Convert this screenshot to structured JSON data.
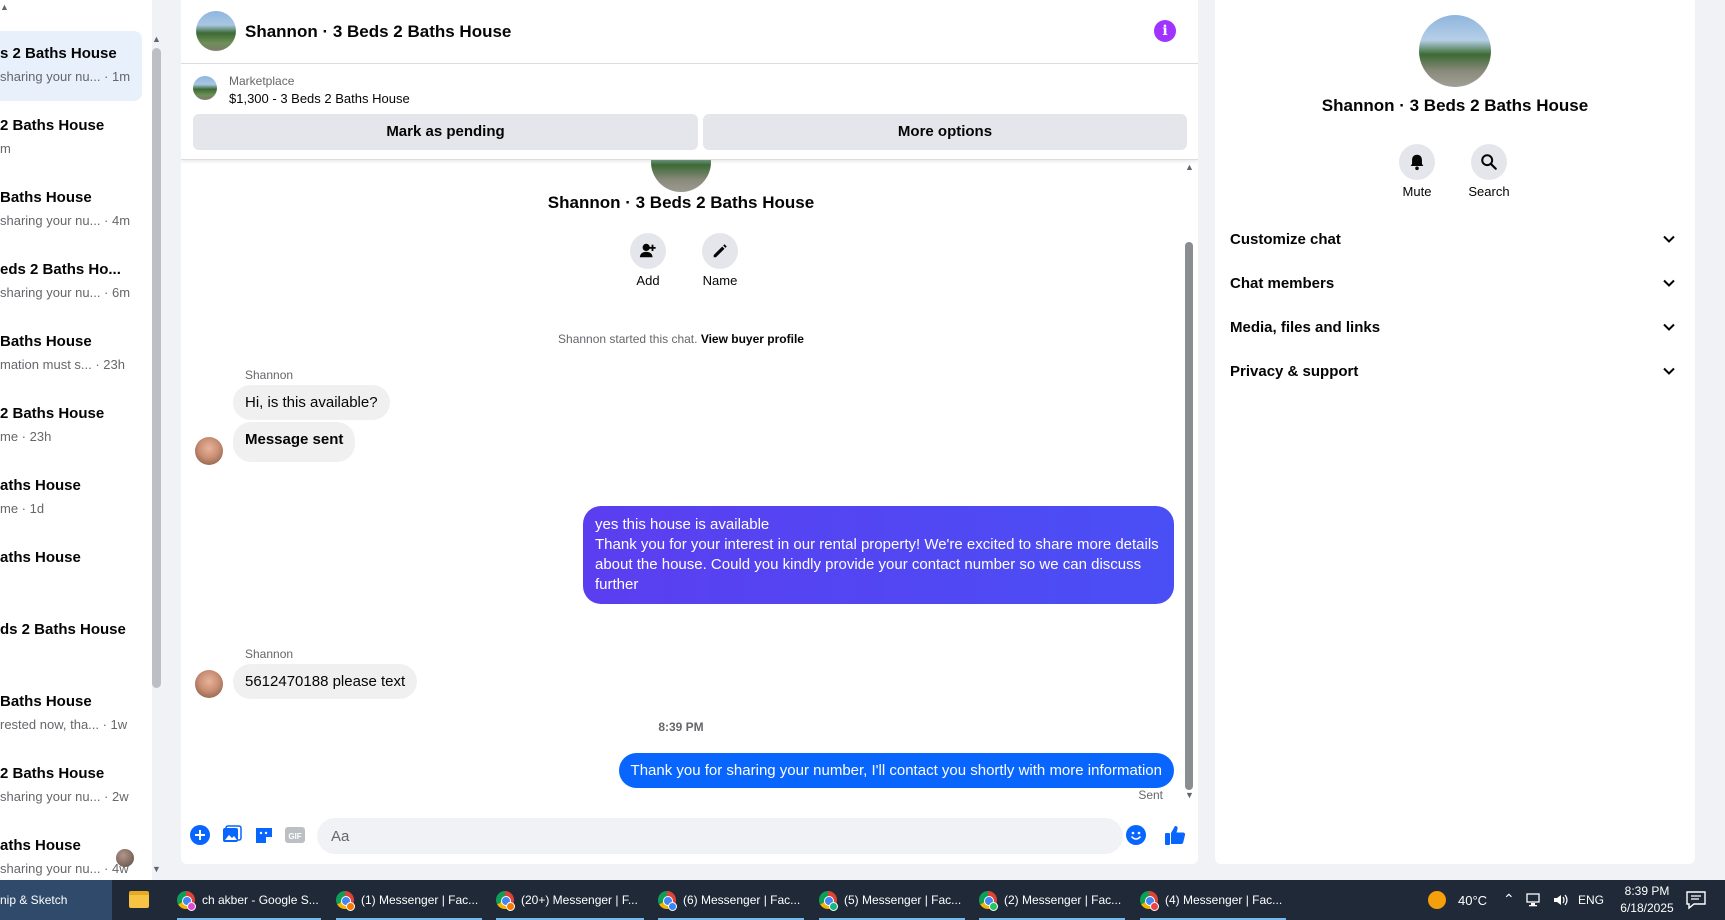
{
  "chat_list": {
    "items": [
      {
        "title": "s 2 Baths House",
        "subtitle": "sharing your nu... · 1m",
        "active": true
      },
      {
        "title": "2 Baths House",
        "subtitle": "m",
        "active": false
      },
      {
        "title": "Baths House",
        "subtitle": "sharing your nu... · 4m",
        "active": false
      },
      {
        "title": "eds 2 Baths Ho...",
        "subtitle": "sharing your nu... · 6m",
        "active": false
      },
      {
        "title": "Baths House",
        "subtitle": "mation must s... · 23h",
        "active": false
      },
      {
        "title": "2 Baths House",
        "subtitle": "me · 23h",
        "active": false
      },
      {
        "title": "aths House",
        "subtitle": "me · 1d",
        "active": false
      },
      {
        "title": "aths House",
        "subtitle": "",
        "active": false
      },
      {
        "title": "ds 2 Baths House",
        "subtitle": "",
        "active": false
      },
      {
        "title": "Baths House",
        "subtitle": "rested now, tha... · 1w",
        "active": false
      },
      {
        "title": "2 Baths House",
        "subtitle": "sharing your nu... · 2w",
        "active": false
      },
      {
        "title": "aths House",
        "subtitle": "sharing your nu... · 4w",
        "active": false
      }
    ]
  },
  "conversation": {
    "title": "Shannon · 3 Beds 2 Baths House",
    "listing": {
      "source": "Marketplace",
      "description": "$1,300 - 3 Beds 2 Baths House",
      "pending_label": "Mark as pending",
      "more_label": "More options"
    },
    "intro": {
      "name": "Shannon · 3 Beds 2 Baths House",
      "add_label": "Add",
      "name_label": "Name",
      "started_text": "Shannon started this chat.",
      "profile_link": "View buyer profile"
    },
    "messages": {
      "sender_1": "Shannon",
      "in_1": "Hi, is this available?",
      "in_2": "Message sent",
      "out_1": "yes this house is available\nThank you for your interest in our rental property! We're excited to share more details about the house. Could you kindly provide your contact number so we can discuss further",
      "sender_2": "Shannon",
      "in_3": "5612470188 please text",
      "time_divider": "8:39 PM",
      "out_2": "Thank you for sharing your number, I'll contact you shortly with more information",
      "status": "Sent"
    },
    "composer": {
      "placeholder": "Aa",
      "value": ""
    }
  },
  "info_panel": {
    "name": "Shannon · 3 Beds 2 Baths House",
    "mute_label": "Mute",
    "search_label": "Search",
    "sections": [
      {
        "label": "Customize chat"
      },
      {
        "label": "Chat members"
      },
      {
        "label": "Media, files and links"
      },
      {
        "label": "Privacy & support"
      }
    ]
  },
  "taskbar": {
    "snip_label": "nip & Sketch",
    "items": [
      {
        "label": "ch akber - Google S..."
      },
      {
        "label": "(1) Messenger | Fac..."
      },
      {
        "label": "(20+) Messenger | F..."
      },
      {
        "label": "(6) Messenger | Fac..."
      },
      {
        "label": "(5) Messenger | Fac..."
      },
      {
        "label": "(2) Messenger | Fac..."
      },
      {
        "label": "(4) Messenger | Fac..."
      }
    ],
    "weather": "40°C",
    "language": "ENG",
    "time": "8:39 PM",
    "date": "6/18/2025"
  },
  "colors": {
    "accent_blue": "#0866ff",
    "gradient_purple": "#5b3ef0",
    "info_purple": "#a033ff"
  }
}
